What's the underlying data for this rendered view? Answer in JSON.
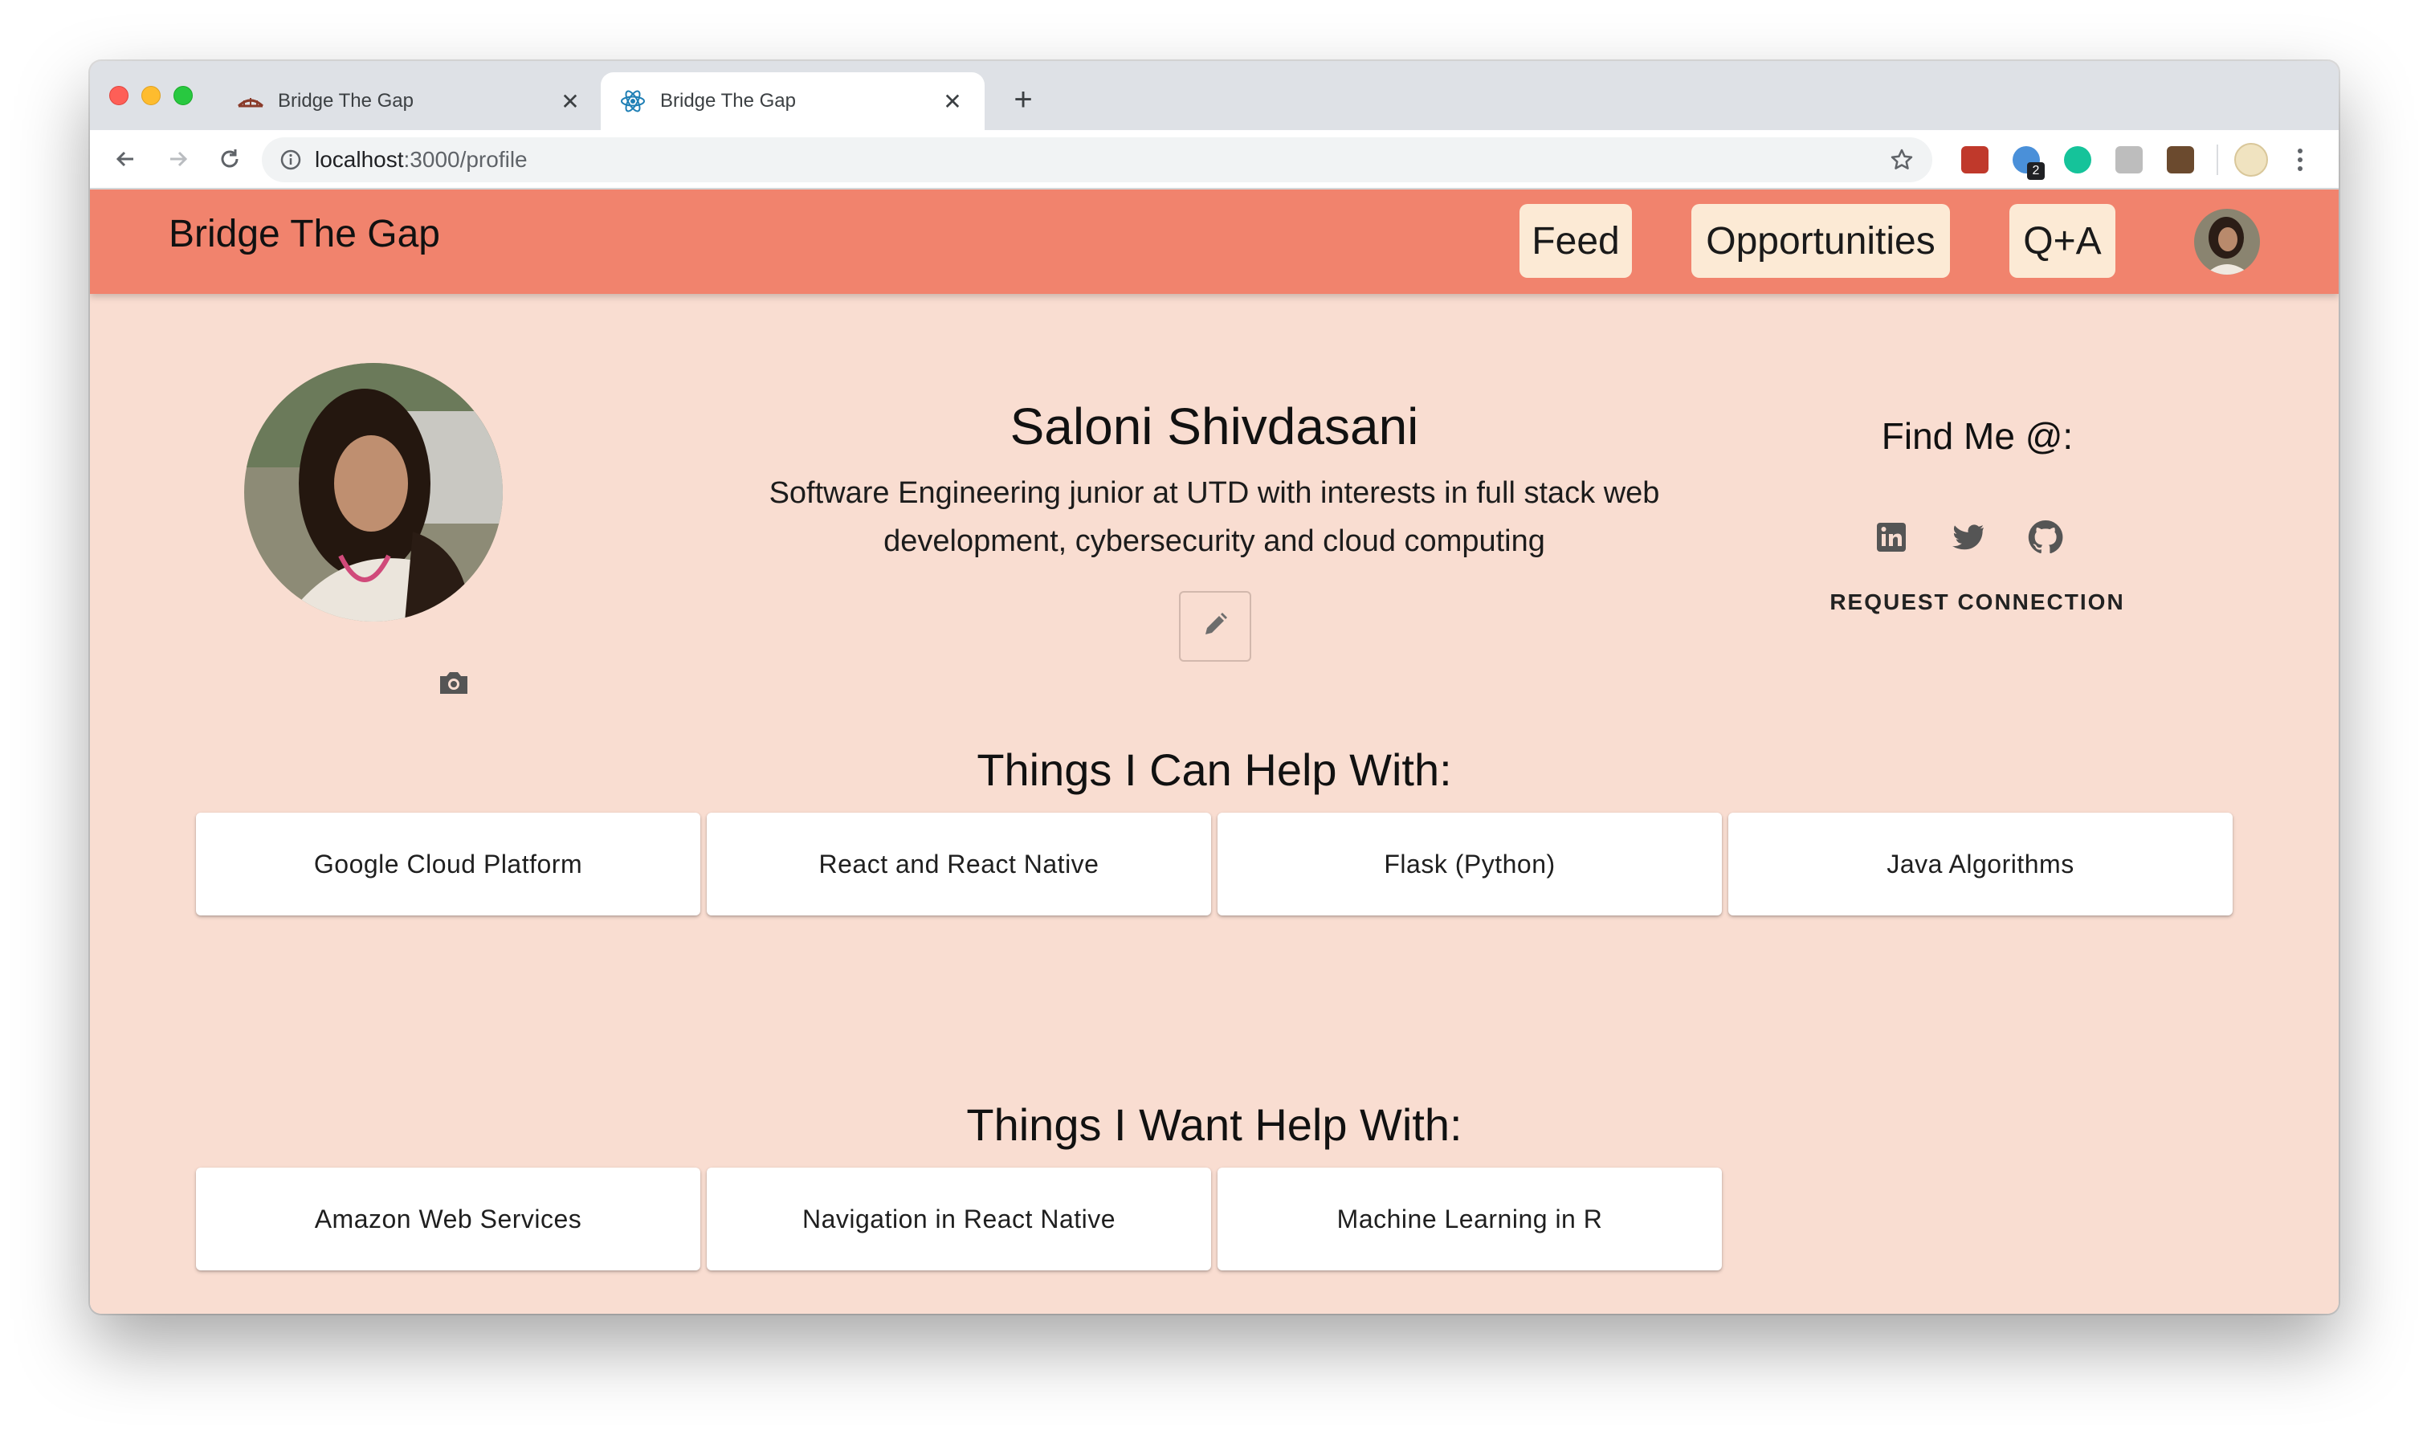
{
  "browser": {
    "tabs": [
      {
        "title": "Bridge The Gap",
        "favicon": "bridge-icon",
        "active": false
      },
      {
        "title": "Bridge The Gap",
        "favicon": "react-icon",
        "active": true
      }
    ],
    "new_tab": "+",
    "close_glyph": "✕",
    "url_host": "localhost",
    "url_path": ":3000/profile",
    "extension_badge": "2"
  },
  "app": {
    "brand": "Bridge The Gap",
    "nav": [
      "Feed",
      "Opportunities",
      "Q+A"
    ]
  },
  "profile": {
    "name": "Saloni Shivdasani",
    "bio_line1": "Software Engineering junior at UTD with interests in full stack web",
    "bio_line2": "development, cybersecurity and cloud computing",
    "find_me": "Find Me @:",
    "social": [
      "linkedin-icon",
      "twitter-icon",
      "github-icon"
    ],
    "request_connection": "REQUEST CONNECTION"
  },
  "can_help": {
    "title": "Things I Can Help With:",
    "items": [
      "Google Cloud Platform",
      "React and React Native",
      "Flask (Python)",
      "Java Algorithms"
    ]
  },
  "want_help": {
    "title": "Things I Want Help With:",
    "items": [
      "Amazon Web Services",
      "Navigation in React Native",
      "Machine Learning in R"
    ]
  },
  "colors": {
    "appbar": "#f1836d",
    "page_bg": "#f9ddd1",
    "nav_pill": "#fcead5"
  }
}
